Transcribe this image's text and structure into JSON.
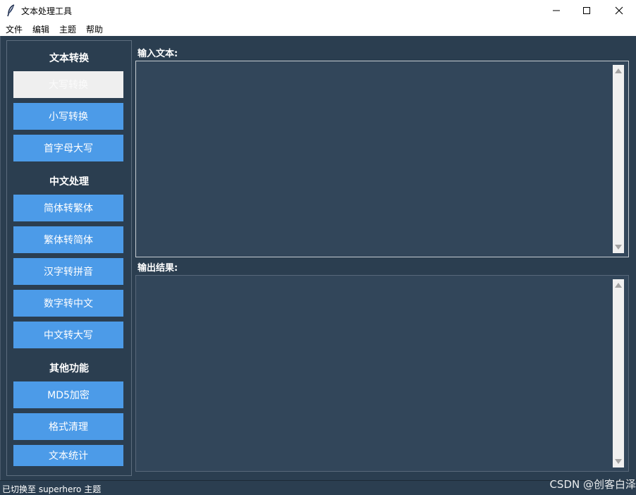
{
  "window": {
    "title": "文本处理工具",
    "icons": {
      "app": "feather-icon",
      "minimize": "minimize-icon",
      "maximize": "maximize-icon",
      "close": "close-icon"
    }
  },
  "menu": {
    "items": [
      "文件",
      "编辑",
      "主题",
      "帮助"
    ]
  },
  "sidebar": {
    "sections": [
      {
        "title": "文本转换",
        "buttons": [
          "大写转换",
          "小写转换",
          "首字母大写"
        ]
      },
      {
        "title": "中文处理",
        "buttons": [
          "简体转繁体",
          "繁体转简体",
          "汉字转拼音",
          "数字转中文",
          "中文转大写"
        ]
      },
      {
        "title": "其他功能",
        "buttons": [
          "MD5加密",
          "格式清理",
          "文本统计"
        ]
      }
    ],
    "active_button": "大写转换"
  },
  "input": {
    "label": "输入文本:",
    "value": ""
  },
  "output": {
    "label": "输出结果:",
    "value": ""
  },
  "status": {
    "text": "已切换至 superhero 主题"
  },
  "watermark": "CSDN @创客白泽",
  "colors": {
    "background": "#2b3e50",
    "textbox": "#32465a",
    "button": "#4c9be8",
    "active_button": "#efefef"
  }
}
